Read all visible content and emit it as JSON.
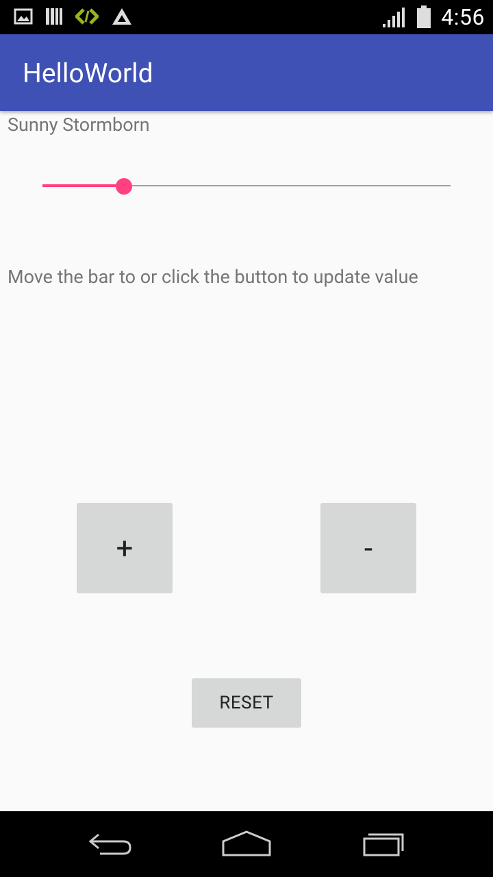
{
  "status_bar": {
    "time": "4:56",
    "icons": [
      "image-notification-icon",
      "library-icon",
      "code-tool-icon",
      "triangle-app-icon",
      "signal-icon",
      "battery-icon"
    ]
  },
  "app_bar": {
    "title": "HelloWorld",
    "color": "#3f51b5"
  },
  "main": {
    "name_text": "Sunny Stormborn",
    "slider": {
      "fraction": 0.2,
      "accent_color": "#ff4081"
    },
    "hint_text": "Move the bar to or click the button to update value",
    "plus_label": "+",
    "minus_label": "-",
    "reset_label": "RESET"
  },
  "nav_bar": {
    "icons": [
      "back-icon",
      "home-icon",
      "recents-icon"
    ]
  }
}
